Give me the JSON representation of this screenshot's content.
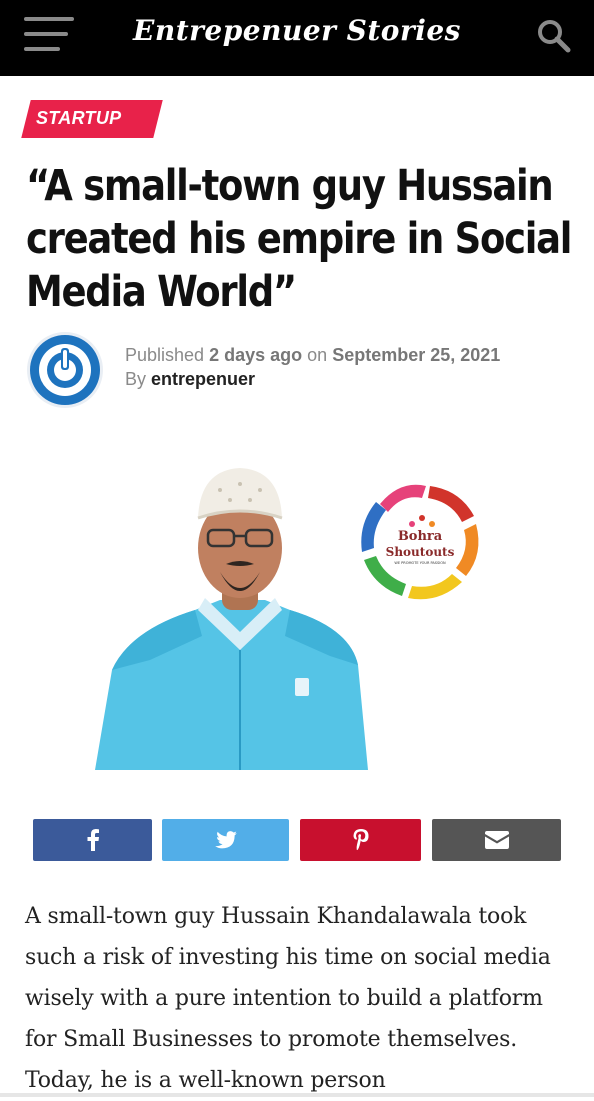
{
  "header": {
    "site_title": "Entrepenuer Stories",
    "menu_icon": "hamburger-menu-icon",
    "search_icon": "search-icon"
  },
  "article": {
    "category": "STARTUP",
    "title": "“A small-town guy Hussain created his empire in Social Media World”",
    "meta": {
      "published_prefix": "Published",
      "relative_time": "2 days ago",
      "on": "on",
      "date": "September 25, 2021",
      "by": "By",
      "author": "entrepenuer"
    },
    "hero_logo": {
      "line1": "Bohra",
      "line2": "Shoutouts",
      "tagline": "WE PROMOTE YOUR PASSION"
    },
    "body_text": "A small-town guy Hussain Khandalawala took such a risk of investing his time on social media wisely with a pure intention to build a platform for Small Businesses to promote themselves. Today, he is a well-known person"
  },
  "share": {
    "facebook_icon": "facebook-icon",
    "twitter_icon": "twitter-icon",
    "pinterest_icon": "pinterest-icon",
    "email_icon": "email-icon"
  },
  "colors": {
    "header_bg": "#000000",
    "category_bg": "#e8224a",
    "facebook": "#3b5a9a",
    "twitter": "#52aee8",
    "pinterest": "#c8102e",
    "email": "#555555",
    "avatar_blue": "#1e73be"
  }
}
